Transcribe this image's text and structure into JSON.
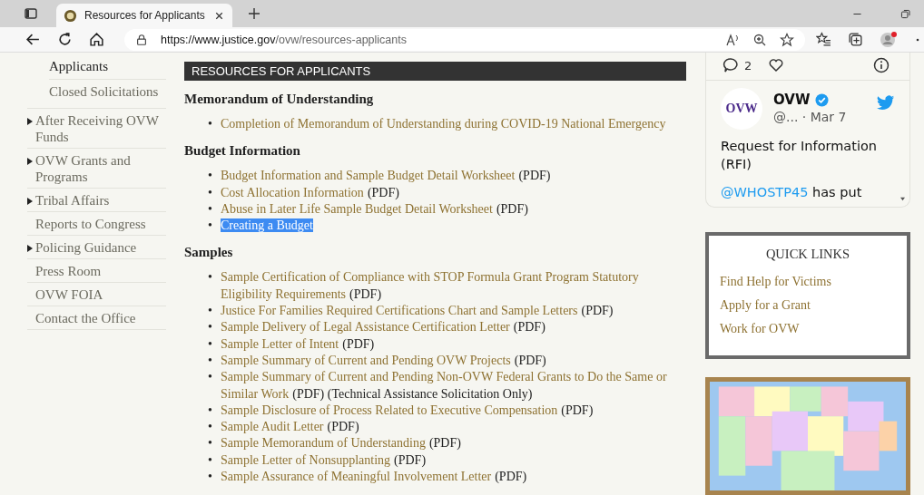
{
  "browser": {
    "tab_title": "Resources for Applicants",
    "url_host": "https://www.justice.gov",
    "url_path": "/ovw/resources-applicants"
  },
  "sidebar": {
    "subitems": [
      {
        "label": "Applicants",
        "selected": true
      },
      {
        "label": "Closed Solicitations",
        "selected": false
      }
    ],
    "items": [
      {
        "label": "After Receiving OVW Funds",
        "expandable": true
      },
      {
        "label": "OVW Grants and Programs",
        "expandable": true
      },
      {
        "label": "Tribal Affairs",
        "expandable": true
      },
      {
        "label": "Reports to Congress",
        "expandable": false
      },
      {
        "label": "Policing Guidance",
        "expandable": true
      },
      {
        "label": "Press Room",
        "expandable": false
      },
      {
        "label": "OVW FOIA",
        "expandable": false
      },
      {
        "label": "Contact the Office",
        "expandable": false
      }
    ]
  },
  "main": {
    "title": "RESOURCES FOR APPLICANTS",
    "sections": [
      {
        "heading": "Memorandum of Understanding",
        "items": [
          {
            "marker": "•",
            "link": [
              "Completion of Memorandum of Understanding during COVID-19 National Emergency"
            ],
            "highlighted": false
          }
        ]
      },
      {
        "heading": "Budget Information",
        "items": [
          {
            "marker": "•",
            "link": [
              "Budget Information and Sample Budget Detail Worksheet"
            ],
            "suffix": "(PDF)",
            "highlighted": false
          },
          {
            "marker": "•",
            "link": [
              "Cost Allocation Information"
            ],
            "suffix": "(PDF)",
            "highlighted": false
          },
          {
            "marker": "•",
            "link": [
              "Abuse in Later Life Sample Budget Detail Worksheet"
            ],
            "suffix": "(PDF)",
            "highlighted": false
          },
          {
            "marker": "•",
            "link": [
              "Creating a Budget"
            ],
            "highlighted": true
          }
        ]
      },
      {
        "heading": "Samples",
        "items": [
          {
            "marker": "•",
            "link": [
              "Sample Certification of Compliance with STOP Formula Grant Program Statutory",
              "Eligibility Requirements"
            ],
            "suffix": "(PDF)",
            "highlighted": false
          },
          {
            "marker": "•",
            "link": [
              "Justice For Families Required Certifications Chart and Sample Letters"
            ],
            "suffix": "(PDF)",
            "highlighted": false
          },
          {
            "marker": "•",
            "link": [
              "Sample Delivery of Legal Assistance Certification Letter"
            ],
            "suffix": "(PDF)",
            "highlighted": false
          },
          {
            "marker": "•",
            "link": [
              "Sample Letter of Intent"
            ],
            "suffix": "(PDF)",
            "highlighted": false
          },
          {
            "marker": "•",
            "link": [
              "Sample Summary of Current and Pending OVW Projects"
            ],
            "suffix": "(PDF)",
            "highlighted": false
          },
          {
            "marker": "•",
            "link": [
              "Sample Summary of Current and Pending Non-OVW Federal Grants to Do the Same or",
              "Similar Work"
            ],
            "suffix": "(PDF) (Technical Assistance Solicitation Only)",
            "highlighted": false
          },
          {
            "marker": "•",
            "link": [
              "Sample Disclosure of Process Related to Executive Compensation"
            ],
            "suffix": "(PDF)",
            "highlighted": false
          },
          {
            "marker": "•",
            "link": [
              "Sample Audit Letter"
            ],
            "suffix": "(PDF)",
            "highlighted": false
          },
          {
            "marker": "•",
            "link": [
              "Sample Memorandum of Understanding"
            ],
            "suffix": "(PDF)",
            "highlighted": false
          },
          {
            "marker": "•",
            "link": [
              "Sample Letter of Nonsupplanting"
            ],
            "suffix": "(PDF)",
            "highlighted": false
          },
          {
            "marker": "•",
            "link": [
              "Sample Assurance of Meaningful Involvement Letter"
            ],
            "suffix": "(PDF)",
            "highlighted": false
          }
        ]
      }
    ]
  },
  "tweet": {
    "reply_count": "2",
    "avatar_logo": "OVW",
    "author": "OVW",
    "handle": "@...",
    "date": "· Mar 7",
    "text": "Request for Information (RFI)",
    "mention": "@WHOSTP45",
    "text_after": "has put"
  },
  "quick_links": {
    "title": "QUICK LINKS",
    "links": [
      "Find Help for Victims",
      "Apply for a Grant",
      "Work for OVW"
    ]
  }
}
